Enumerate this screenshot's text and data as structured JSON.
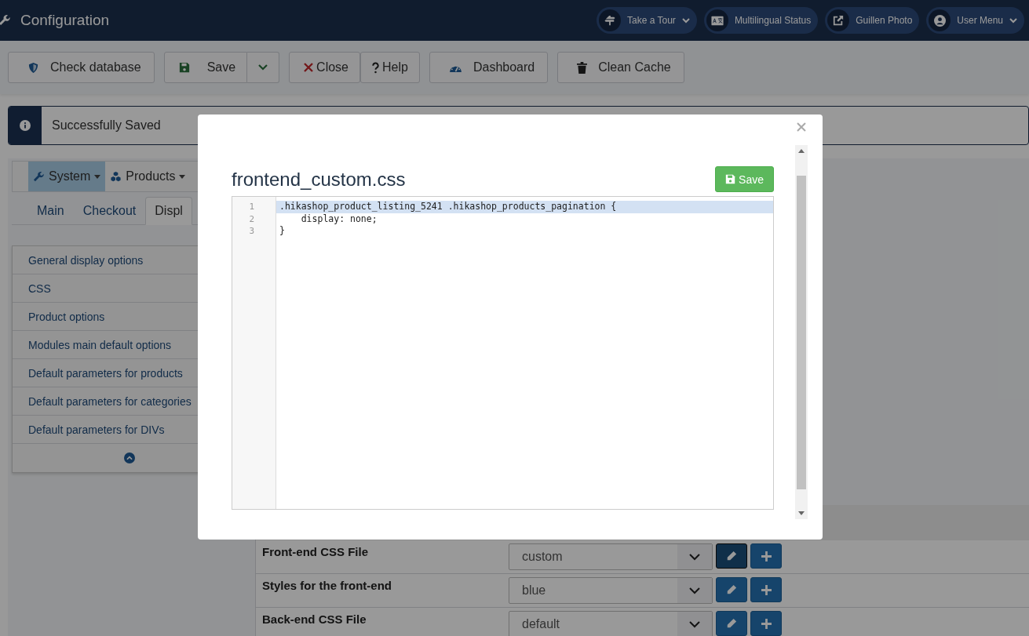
{
  "header": {
    "title": "Configuration",
    "items": [
      {
        "label": "Take a Tour",
        "kind": "tour",
        "caret": true
      },
      {
        "label": "Multilingual Status",
        "kind": "language",
        "caret": false
      },
      {
        "label": "Guillen Photo",
        "kind": "external",
        "caret": false
      },
      {
        "label": "User Menu",
        "kind": "user",
        "caret": true
      }
    ]
  },
  "toolbar": [
    {
      "label": "Check database",
      "kind": "shield",
      "split": false
    },
    {
      "label": "Save",
      "kind": "save",
      "split": true
    },
    {
      "label": "Close",
      "kind": "close",
      "split": false
    },
    {
      "label": "Help",
      "kind": "help",
      "split": false
    },
    {
      "label": "Dashboard",
      "kind": "gauge",
      "split": false
    },
    {
      "label": "Clean Cache",
      "kind": "trash",
      "split": false
    }
  ],
  "message": "Successfully Saved",
  "menu": [
    {
      "label": "System",
      "kind": "wrench",
      "selected": true
    },
    {
      "label": "Products",
      "kind": "cubes",
      "selected": false
    }
  ],
  "tabs": [
    {
      "label": "Main",
      "selected": false
    },
    {
      "label": "Checkout",
      "selected": false
    },
    {
      "label": "Displ",
      "selected": true
    }
  ],
  "sidebar": {
    "items": [
      {
        "label": "General display options"
      },
      {
        "label": "CSS"
      },
      {
        "label": "Product options"
      },
      {
        "label": "Modules main default options"
      },
      {
        "label": "Default parameters for products"
      },
      {
        "label": "Default parameters for categories"
      },
      {
        "label": "Default parameters for DIVs"
      }
    ]
  },
  "settings": [
    {
      "label": "Front-end CSS File",
      "value": "custom"
    },
    {
      "label": "Styles for the front-end",
      "value": "blue"
    },
    {
      "label": "Back-end CSS File",
      "value": "default"
    }
  ],
  "modal": {
    "title": "frontend_custom.css",
    "save": "Save",
    "lines": [
      {
        "number": "1",
        "text": ".hikashop_product_listing_5241 .hikashop_products_pagination {",
        "highlighted": true
      },
      {
        "number": "2",
        "text": "    display: none;",
        "highlighted": false
      },
      {
        "number": "3",
        "text": "}",
        "highlighted": false
      }
    ]
  }
}
